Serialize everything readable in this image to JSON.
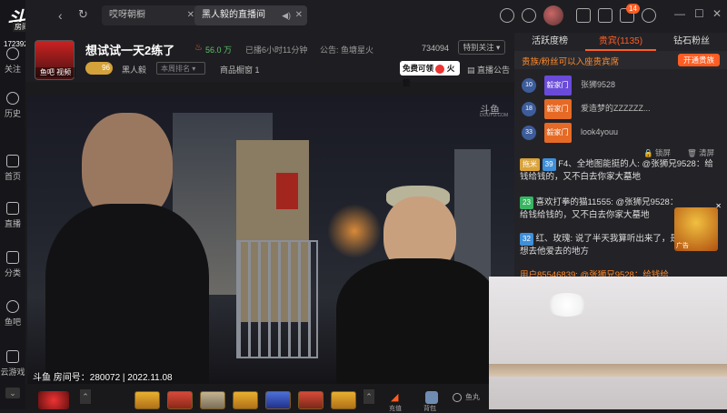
{
  "app": {
    "logo_text": "斗鱼",
    "room_label": "房间号",
    "room_badge_text": "172392"
  },
  "nav": {
    "items": [
      {
        "label": "关注"
      },
      {
        "label": "历史"
      },
      {
        "label": "首页"
      },
      {
        "label": "直播"
      },
      {
        "label": "分类"
      },
      {
        "label": "鱼吧"
      },
      {
        "label": "云游戏"
      }
    ]
  },
  "tabs": [
    {
      "label": "哎呀朝橱",
      "active": false
    },
    {
      "label": "黑人毅的直播间",
      "active": true
    }
  ],
  "topbar": {
    "notify_count": "14"
  },
  "room": {
    "title": "想试试一天2练了",
    "heat": "56.0 万",
    "live_time": "已播6小时11分钟",
    "notice": "公告: 鱼塘星火",
    "fans": "734094",
    "follow_label": "特别关注",
    "streamer_name": "黑人毅",
    "fan_level": "96",
    "rank_placeholder": "本周排名",
    "products": "商品橱窗 1",
    "free_gift": "免费可领",
    "free_gift_suffix": "火箭",
    "announcement": "直播公告",
    "avatar_label": "鱼吧 视频"
  },
  "video": {
    "watermark": "斗鱼",
    "watermark_sub": "DOUYU.COM",
    "overlay": "斗鱼 房间号：280072 | 2022.11.08"
  },
  "right": {
    "tabs": [
      {
        "label": "活跃度榜"
      },
      {
        "label": "贵宾(1135)"
      },
      {
        "label": "钻石粉丝"
      }
    ],
    "vip_notice": "贵族/粉丝可以入座贵宾席",
    "vip_button": "开通贵族",
    "vip_list": [
      {
        "level": "10",
        "badge": "毅家门",
        "name": "张狮9528"
      },
      {
        "level": "18",
        "badge": "毅家门",
        "name": "爱造梦的ZZZZZZ..."
      },
      {
        "level": "33",
        "badge": "毅家门",
        "name": "look4youu"
      }
    ],
    "lock_label": "锁屏",
    "clear_label": "清屏",
    "chat": [
      {
        "level": "39",
        "text": "F4、全地图能挺的人: @张狮兄9528：给钱给钱的，又不白去你家大墓地"
      },
      {
        "level": "23",
        "text": "喜欢打拳的猫11555: @张狮兄9528：给钱给钱的，又不白去你家大墓地"
      },
      {
        "level": "32",
        "text": "红、玫瑰: 说了半天我算听出来了，是想去他爱去的地方"
      },
      {
        "level": "",
        "text": "用户85546839: @张狮兄9528：给钱给"
      }
    ],
    "chat_badge": "拖米",
    "ad_label": "广告"
  },
  "bottom": {
    "fish_label": "鱼丸",
    "action1": "充值",
    "action2": "背包"
  },
  "colors": {
    "accent": "#ff5d23",
    "vip_orange": "#ff8a2b",
    "bg": "#1b1b1e"
  }
}
